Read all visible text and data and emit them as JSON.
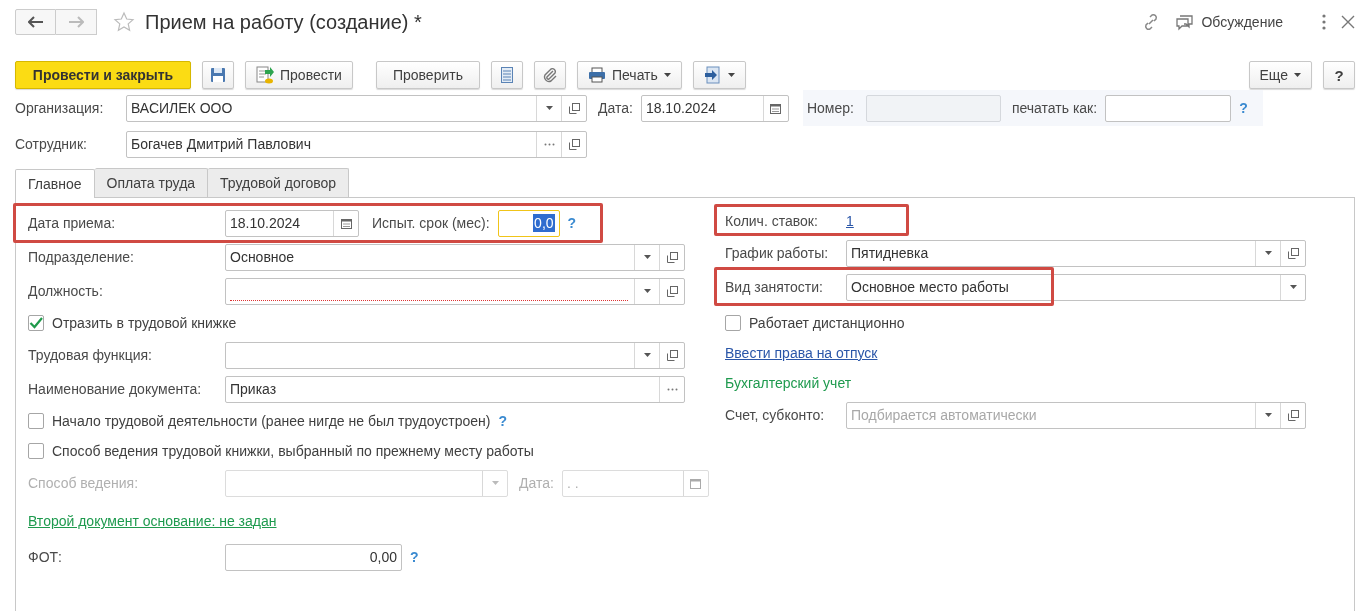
{
  "header": {
    "title": "Прием на работу (создание) *",
    "discussion": "Обсуждение"
  },
  "toolbar": {
    "post_close": "Провести и закрыть",
    "post": "Провести",
    "check": "Проверить",
    "print": "Печать",
    "more": "Еще",
    "help": "?"
  },
  "document": {
    "organization": {
      "label": "Организация:",
      "value": "ВАСИЛЕК ООО"
    },
    "date": {
      "label": "Дата:",
      "value": "18.10.2024"
    },
    "number": {
      "label": "Номер:",
      "disabled": true
    },
    "print_as": {
      "label": "печатать как:",
      "help": "?"
    },
    "employee": {
      "label": "Сотрудник:",
      "value": "Богачев Дмитрий Павлович"
    }
  },
  "tabs": [
    {
      "label": "Главное",
      "selected": true
    },
    {
      "label": "Оплата труда",
      "selected": false
    },
    {
      "label": "Трудовой договор",
      "selected": false
    }
  ],
  "left": [
    {
      "kind": "date_probation",
      "label": "Дата приема:",
      "value": "18.10.2024",
      "label2": "Испыт. срок (мес):",
      "value2": "0,0",
      "focused": true,
      "help": "?",
      "highlighted": true
    },
    {
      "kind": "select",
      "label": "Подразделение:",
      "value": "Основное",
      "open_button": true
    },
    {
      "kind": "select",
      "label": "Должность:",
      "open_button": true,
      "required": true
    },
    {
      "kind": "checkbox",
      "label": "Отразить в трудовой книжке",
      "checked": true
    },
    {
      "kind": "select",
      "label": "Трудовая функция:",
      "open_button": true
    },
    {
      "kind": "choice",
      "label": "Наименование документа:",
      "value": "Приказ"
    },
    {
      "kind": "checkbox",
      "label": "Начало трудовой деятельности (ранее нигде не был трудоустроен)",
      "checked": false,
      "help": "?"
    },
    {
      "kind": "checkbox",
      "label": "Способ ведения трудовой книжки, выбранный по прежнему месту работы",
      "checked": false
    },
    {
      "kind": "method_date",
      "label": "Способ ведения:",
      "label2": "Дата:",
      "value2": ". .",
      "disabled": true
    },
    {
      "kind": "link",
      "label": "Второй документ основание: не задан",
      "color": "#1e9a4e"
    },
    {
      "kind": "number",
      "label": "ФОТ:",
      "value": "0,00",
      "help": "?"
    }
  ],
  "right": [
    {
      "kind": "link_value",
      "label": "Колич. ставок:",
      "value": "1",
      "highlighted": true
    },
    {
      "kind": "select",
      "label": "График работы:",
      "value": "Пятидневка",
      "open_button": true
    },
    {
      "kind": "select",
      "label": "Вид занятости:",
      "value": "Основное место работы",
      "highlighted": true
    },
    {
      "kind": "checkbox",
      "label": "Работает дистанционно",
      "checked": false
    },
    {
      "kind": "link",
      "label": "Ввести права на отпуск",
      "color": "#2a56a8"
    },
    {
      "kind": "section",
      "label": "Бухгалтерский учет"
    },
    {
      "kind": "select",
      "label": "Счет, субконто:",
      "placeholder": "Подбирается автоматически",
      "open_button": true
    }
  ]
}
